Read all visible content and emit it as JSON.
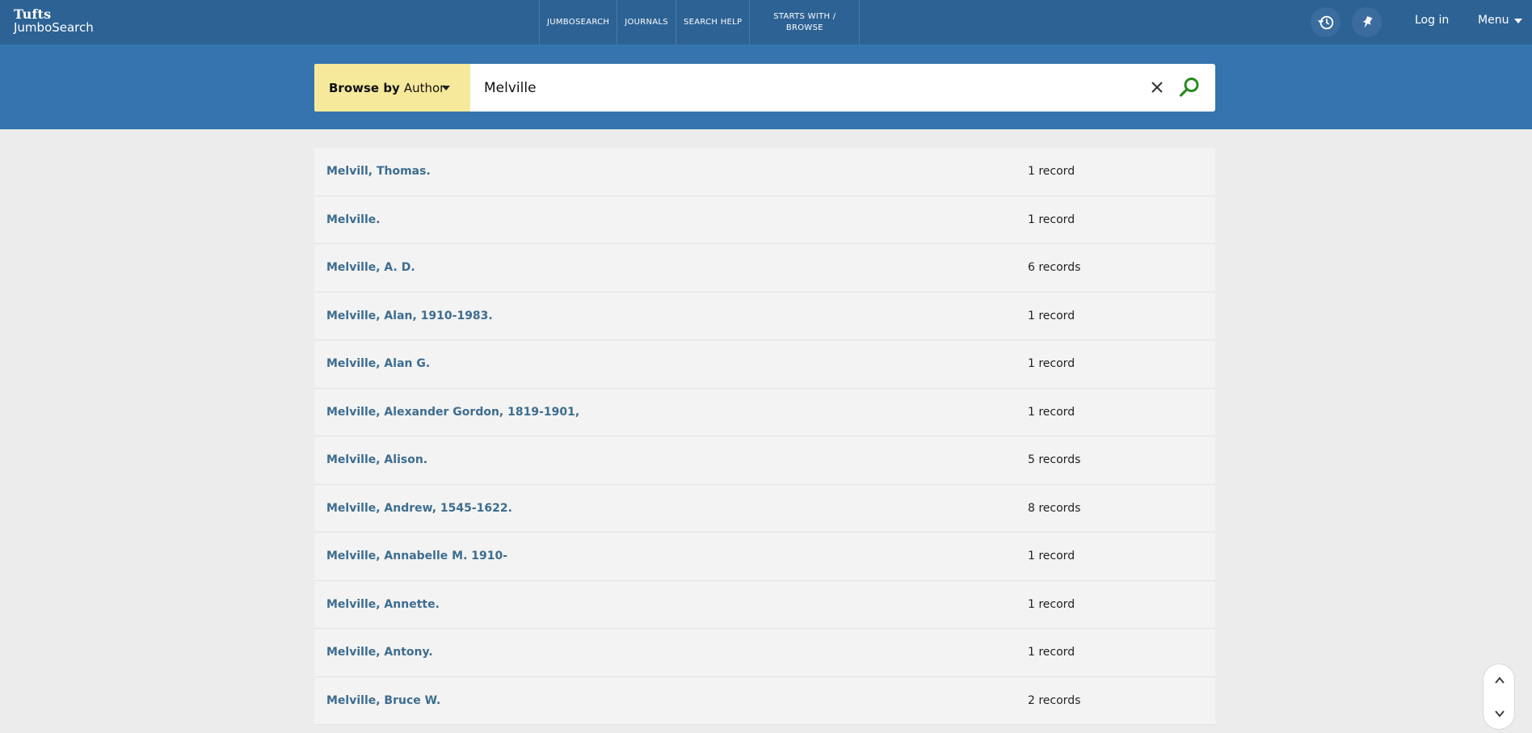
{
  "brand": {
    "line1": "Tufts",
    "line2": "JumboSearch"
  },
  "nav": [
    {
      "label": "JUMBOSEARCH"
    },
    {
      "label": "JOURNALS"
    },
    {
      "label": "SEARCH HELP"
    },
    {
      "label_line1": "STARTS WITH /",
      "label_line2": "BROWSE"
    }
  ],
  "header": {
    "login": "Log in",
    "menu": "Menu"
  },
  "icons": {
    "history": "history-icon",
    "pin": "pin-icon"
  },
  "search": {
    "browse_prefix": "Browse by",
    "browse_value": "Author",
    "query": "Melville"
  },
  "results": [
    {
      "name": "Melvill, Thomas.",
      "count": "1 record"
    },
    {
      "name": "Melville.",
      "count": "1 record"
    },
    {
      "name": "Melville, A. D.",
      "count": "6 records"
    },
    {
      "name": "Melville, Alan, 1910-1983.",
      "count": "1 record"
    },
    {
      "name": "Melville, Alan G.",
      "count": "1 record"
    },
    {
      "name": "Melville, Alexander Gordon, 1819-1901,",
      "count": "1 record"
    },
    {
      "name": "Melville, Alison.",
      "count": "5 records"
    },
    {
      "name": "Melville, Andrew, 1545-1622.",
      "count": "8 records"
    },
    {
      "name": "Melville, Annabelle M. 1910-",
      "count": "1 record"
    },
    {
      "name": "Melville, Annette.",
      "count": "1 record"
    },
    {
      "name": "Melville, Antony.",
      "count": "1 record"
    },
    {
      "name": "Melville, Bruce W.",
      "count": "2 records"
    }
  ],
  "colors": {
    "topbar": "#2d6294",
    "search_band": "#3574ae",
    "browse_select": "#f6e99b",
    "link": "#3d6d8f",
    "search_icon": "#2a8a1f"
  }
}
